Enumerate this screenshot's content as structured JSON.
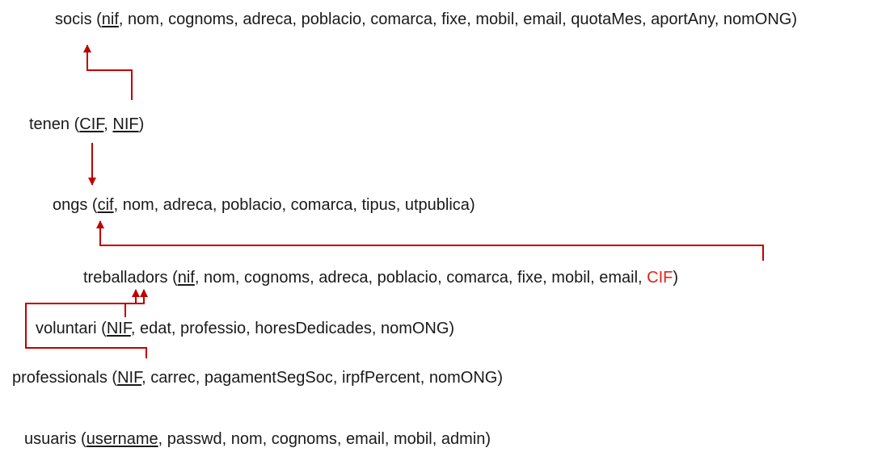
{
  "relations": [
    {
      "id": "socis",
      "name": "socis",
      "attributes": [
        {
          "text": "nif",
          "key": true
        },
        {
          "text": "nom"
        },
        {
          "text": "cognoms"
        },
        {
          "text": "adreca"
        },
        {
          "text": "poblacio"
        },
        {
          "text": "comarca"
        },
        {
          "text": "fixe"
        },
        {
          "text": "mobil"
        },
        {
          "text": "email"
        },
        {
          "text": "quotaMes"
        },
        {
          "text": "aportAny"
        },
        {
          "text": "nomONG"
        }
      ]
    },
    {
      "id": "tenen",
      "name": "tenen",
      "attributes": [
        {
          "text": "CIF",
          "key": true
        },
        {
          "text": "NIF",
          "key": true
        }
      ]
    },
    {
      "id": "ongs",
      "name": "ongs",
      "attributes": [
        {
          "text": "cif",
          "key": true
        },
        {
          "text": "nom"
        },
        {
          "text": "adreca"
        },
        {
          "text": "poblacio"
        },
        {
          "text": "comarca"
        },
        {
          "text": "tipus"
        },
        {
          "text": "utpublica"
        }
      ]
    },
    {
      "id": "treballadors",
      "name": "treballadors",
      "attributes": [
        {
          "text": "nif",
          "key": true
        },
        {
          "text": "nom"
        },
        {
          "text": "cognoms"
        },
        {
          "text": "adreca"
        },
        {
          "text": "poblacio"
        },
        {
          "text": "comarca"
        },
        {
          "text": "fixe"
        },
        {
          "text": "mobil"
        },
        {
          "text": "email"
        },
        {
          "text": "CIF",
          "highlight": true
        }
      ]
    },
    {
      "id": "voluntari",
      "name": "voluntari",
      "attributes": [
        {
          "text": "NIF",
          "key": true
        },
        {
          "text": "edat"
        },
        {
          "text": "professio"
        },
        {
          "text": "horesDedicades"
        },
        {
          "text": "nomONG"
        }
      ]
    },
    {
      "id": "professionals",
      "name": "professionals",
      "attributes": [
        {
          "text": "NIF",
          "key": true
        },
        {
          "text": "carrec"
        },
        {
          "text": "pagamentSegSoc"
        },
        {
          "text": "irpfPercent"
        },
        {
          "text": "nomONG"
        }
      ]
    },
    {
      "id": "usuaris",
      "name": "usuaris",
      "attributes": [
        {
          "text": "username",
          "key": true
        },
        {
          "text": "passwd"
        },
        {
          "text": "nom"
        },
        {
          "text": "cognoms"
        },
        {
          "text": "email"
        },
        {
          "text": "mobil"
        },
        {
          "text": "admin"
        }
      ]
    }
  ],
  "references": [
    {
      "from": "tenen",
      "to": "socis"
    },
    {
      "from": "tenen",
      "to": "ongs"
    },
    {
      "from": "treballadors",
      "to": "ongs"
    },
    {
      "from": "voluntari",
      "to": "treballadors"
    },
    {
      "from": "professionals",
      "to": "treballadors"
    }
  ],
  "colors": {
    "text": "#1a1a1a",
    "arrow": "#c00000",
    "foreign_key": "#e0241b"
  }
}
